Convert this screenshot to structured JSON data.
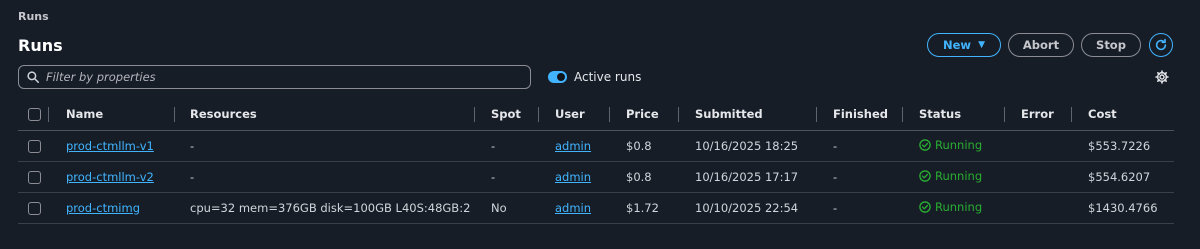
{
  "breadcrumb": "Runs",
  "title": "Runs",
  "actions": {
    "new": "New",
    "abort": "Abort",
    "stop": "Stop"
  },
  "search": {
    "placeholder": "Filter by properties",
    "value": ""
  },
  "toggle": {
    "label": "Active runs",
    "on": true
  },
  "colors": {
    "accent": "#42b4ff",
    "running": "#29ad32",
    "background": "#161d26"
  },
  "columns": [
    "Name",
    "Resources",
    "Spot",
    "User",
    "Price",
    "Submitted",
    "Finished",
    "Status",
    "Error",
    "Cost"
  ],
  "rows": [
    {
      "name": "prod-ctmllm-v1",
      "resources": "-",
      "spot": "-",
      "user": "admin",
      "price": "$0.8",
      "submitted": "10/16/2025 18:25",
      "finished": "-",
      "status": "Running",
      "error": "",
      "cost": "$553.7226"
    },
    {
      "name": "prod-ctmllm-v2",
      "resources": "-",
      "spot": "-",
      "user": "admin",
      "price": "$0.8",
      "submitted": "10/16/2025 17:17",
      "finished": "-",
      "status": "Running",
      "error": "",
      "cost": "$554.6207"
    },
    {
      "name": "prod-ctmimg",
      "resources": "cpu=32 mem=376GB disk=100GB L40S:48GB:2",
      "spot": "No",
      "user": "admin",
      "price": "$1.72",
      "submitted": "10/10/2025 22:54",
      "finished": "-",
      "status": "Running",
      "error": "",
      "cost": "$1430.4766"
    }
  ],
  "icons": {
    "search": "search-icon",
    "refresh": "refresh-icon",
    "settings": "gear-icon",
    "status": "check-circle-icon",
    "caret": "caret-down-icon"
  }
}
